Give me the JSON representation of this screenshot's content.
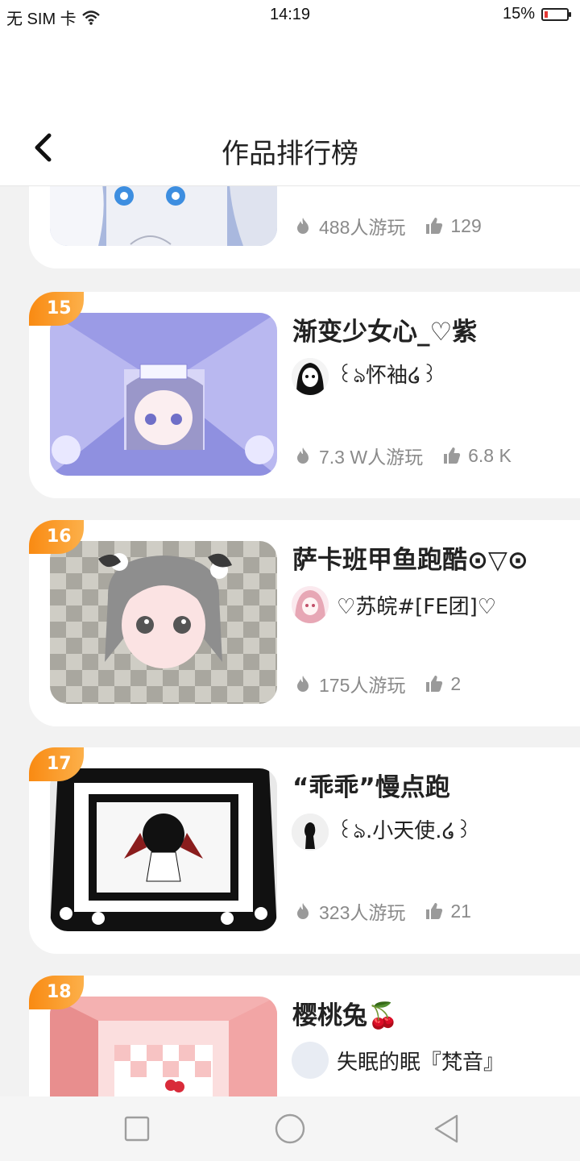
{
  "status_bar": {
    "carrier": "无 SIM 卡",
    "time": "14:19",
    "battery": "15%",
    "battery_level": 0.15,
    "battery_color": "#e53935"
  },
  "header": {
    "title": "作品排行榜"
  },
  "cards": [
    {
      "rank": "",
      "title": "",
      "author": "",
      "plays": "488人游玩",
      "likes": "129"
    },
    {
      "rank": "15",
      "title": "渐变少女心_♡紫",
      "author": "꒰ঌ怀袖໒꒱",
      "plays": "7.3 W人游玩",
      "likes": "6.8 K"
    },
    {
      "rank": "16",
      "title": "萨卡班甲鱼跑酷⊙▽⊙",
      "author": "♡苏皖#[FE团]♡",
      "plays": "175人游玩",
      "likes": "2"
    },
    {
      "rank": "17",
      "title": "“乖乖”慢点跑",
      "author": "꒰ঌ.小天使.໒꒱",
      "plays": "323人游玩",
      "likes": "21"
    },
    {
      "rank": "18",
      "title": "樱桃兔🍒",
      "author": "失眠的眠『梵音』",
      "plays": "",
      "likes": ""
    }
  ],
  "colors": {
    "badge_start": "#f98a12",
    "badge_end": "#fcb04a",
    "stat_gray": "#8a8a8a"
  },
  "icons": {
    "plays": "flame-icon",
    "likes": "thumbs-up-icon"
  }
}
